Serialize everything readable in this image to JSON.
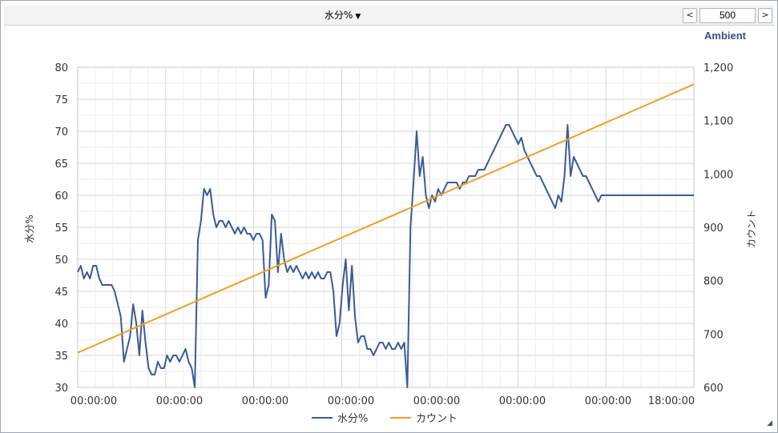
{
  "toolbar": {
    "metric_label": "水分%",
    "prev_label": "<",
    "next_label": ">",
    "count_value": "500"
  },
  "chart_data": {
    "type": "line",
    "title": "Ambient",
    "ylabel": "水分%",
    "y2label": "カウント",
    "ylim": [
      30,
      80
    ],
    "y2lim": [
      600,
      1200
    ],
    "yticks": [
      "30",
      "35",
      "40",
      "45",
      "50",
      "55",
      "60",
      "65",
      "70",
      "75",
      "80"
    ],
    "y2ticks": [
      "600",
      "700",
      "800",
      "900",
      "1,000",
      "1,100",
      "1,200"
    ],
    "xtick_labels": [
      "00:00:00",
      "00:00:00",
      "00:00:00",
      "00:00:00",
      "00:00:00",
      "00:00:00",
      "00:00:00",
      "18:00:00"
    ],
    "x": [
      0,
      1,
      2,
      3,
      4,
      5,
      6,
      7,
      8,
      9,
      10,
      11,
      12,
      13,
      14,
      15,
      16,
      17,
      18,
      19,
      20,
      21,
      22,
      23,
      24,
      25,
      26,
      27,
      28,
      29,
      30,
      31,
      32,
      33,
      34,
      35,
      36,
      37,
      38,
      39,
      40,
      41,
      42,
      43,
      44,
      45,
      46,
      47,
      48,
      49,
      50,
      51,
      52,
      53,
      54,
      55,
      56,
      57,
      58,
      59,
      60,
      61,
      62,
      63,
      64,
      65,
      66,
      67,
      68,
      69,
      70,
      71,
      72,
      73,
      74,
      75,
      76,
      77,
      78,
      79,
      80,
      81,
      82,
      83,
      84,
      85,
      86,
      87,
      88,
      89,
      90,
      91,
      92,
      93,
      94,
      95,
      96,
      97,
      98,
      99,
      100,
      101,
      102,
      103,
      104,
      105,
      106,
      107,
      108,
      109,
      110,
      111,
      112,
      113,
      114,
      115,
      116,
      117,
      118,
      119,
      120,
      121,
      122,
      123,
      124,
      125,
      126,
      127,
      128,
      129,
      130,
      131,
      132,
      133,
      134,
      135,
      136,
      137,
      138,
      139,
      140,
      141,
      142,
      143,
      144,
      145,
      146,
      147,
      148,
      149,
      150,
      151,
      152,
      153,
      154,
      155,
      156,
      157,
      158,
      159,
      160,
      161,
      162,
      163,
      164,
      165,
      166,
      167,
      168,
      169,
      170,
      171,
      172,
      173,
      174,
      175,
      176,
      177,
      178,
      179,
      180,
      181,
      182,
      183,
      184,
      185,
      186,
      187,
      188,
      189,
      190,
      191,
      192,
      193,
      194,
      195,
      196,
      197,
      198,
      199,
      200
    ],
    "series": [
      {
        "name": "水分%",
        "color": "#3b5a9a",
        "axis": "left",
        "values": [
          48,
          49,
          47,
          48,
          47,
          49,
          49,
          47,
          46,
          46,
          46,
          46,
          45,
          43,
          41,
          34,
          36,
          38,
          43,
          40,
          35,
          42,
          37,
          33,
          32,
          32,
          34,
          33,
          33,
          35,
          34,
          35,
          35,
          34,
          35,
          36,
          34,
          33,
          30,
          53,
          56,
          61,
          60,
          61,
          57,
          55,
          56,
          56,
          55,
          56,
          55,
          54,
          55,
          54,
          55,
          54,
          54,
          53,
          54,
          54,
          53,
          44,
          46,
          57,
          56,
          48,
          54,
          50,
          48,
          49,
          48,
          49,
          48,
          47,
          48,
          47,
          48,
          47,
          48,
          47,
          47,
          48,
          48,
          45,
          38,
          40,
          46,
          50,
          42,
          49,
          41,
          37,
          38,
          38,
          36,
          36,
          35,
          36,
          37,
          37,
          36,
          37,
          36,
          36,
          37,
          36,
          37,
          30,
          55,
          62,
          70,
          63,
          66,
          60,
          58,
          60,
          59,
          61,
          60,
          61,
          62,
          62,
          62,
          62,
          61,
          62,
          62,
          63,
          63,
          63,
          64,
          64,
          64,
          65,
          66,
          67,
          68,
          69,
          70,
          71,
          71,
          70,
          69,
          68,
          69,
          67,
          66,
          65,
          64,
          63,
          63,
          62,
          61,
          60,
          59,
          58,
          60,
          59,
          63,
          71,
          63,
          66,
          65,
          64,
          63,
          63,
          62,
          61,
          60,
          59,
          60,
          60,
          60,
          60,
          60,
          60,
          60,
          60,
          60,
          60,
          60,
          60,
          60,
          60,
          60,
          60,
          60,
          60,
          60,
          60,
          60,
          60,
          60,
          60,
          60,
          60,
          60,
          60,
          60,
          60,
          60
        ]
      },
      {
        "name": "カウント",
        "color": "#f0a020",
        "axis": "right",
        "values": [
          665,
          1168
        ]
      }
    ],
    "legend": "bottom-center",
    "grid": true
  }
}
